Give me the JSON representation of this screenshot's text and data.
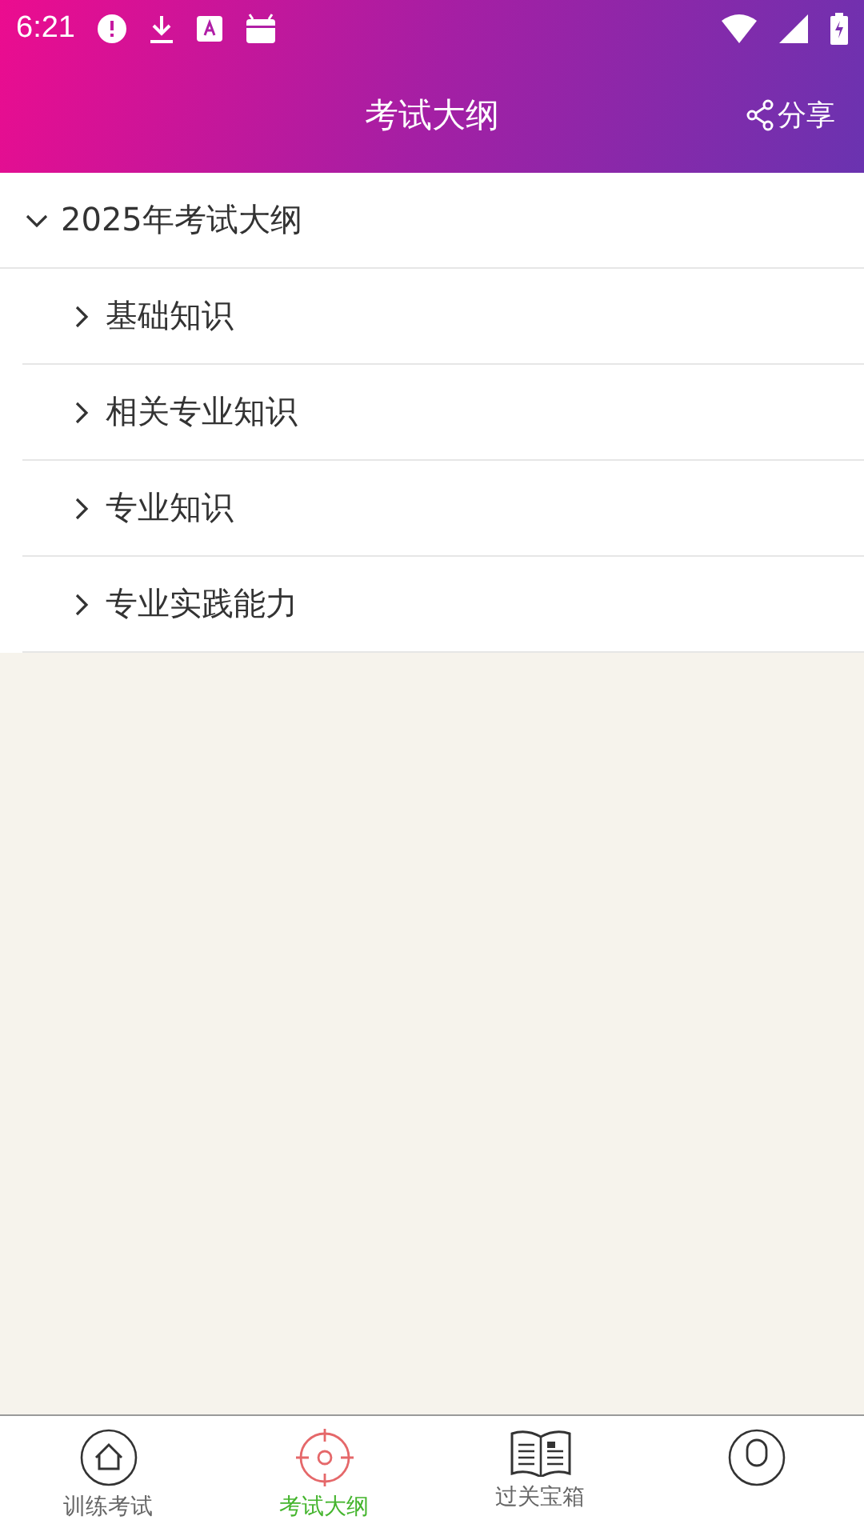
{
  "status_bar": {
    "time": "6:21"
  },
  "header": {
    "title": "考试大纲",
    "share": {
      "label": "分享"
    }
  },
  "outline": [
    {
      "label": "2025年考试大纲",
      "expanded": true,
      "children": [
        {
          "label": "基础知识",
          "expanded": false
        },
        {
          "label": "相关专业知识",
          "expanded": false
        },
        {
          "label": "专业知识",
          "expanded": false
        },
        {
          "label": "专业实践能力",
          "expanded": false
        }
      ]
    }
  ],
  "bottom_nav": [
    {
      "kind": "home",
      "label": "训练考试",
      "selected": false
    },
    {
      "kind": "target",
      "label": "考试大纲",
      "selected": true
    },
    {
      "kind": "book",
      "label": "过关宝箱",
      "selected": false
    },
    {
      "kind": "person",
      "selected": false
    }
  ]
}
